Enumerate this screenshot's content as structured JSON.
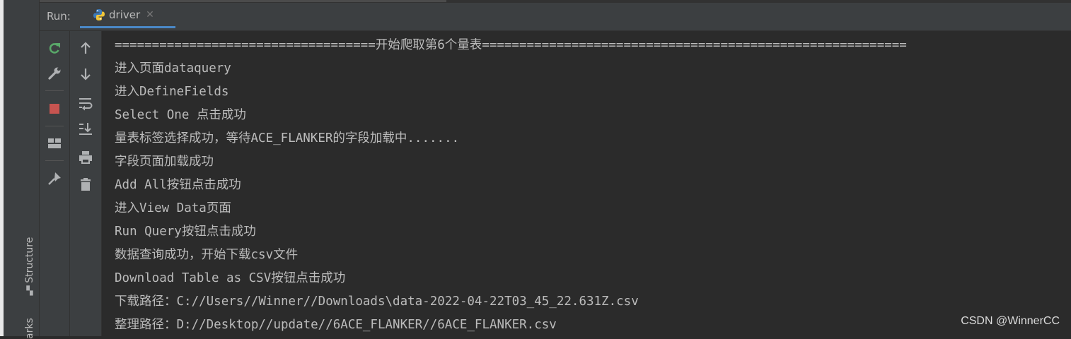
{
  "side": {
    "structure_label": "Structure",
    "bookmarks_label": "arks"
  },
  "run": {
    "label": "Run:",
    "tab_label": "driver"
  },
  "console": {
    "lines": [
      "===================================开始爬取第6个量表=========================================================",
      "进入页面dataquery",
      "进入DefineFields",
      "Select One 点击成功",
      "量表标签选择成功，等待ACE_FLANKER的字段加载中.......",
      "字段页面加载成功",
      "Add All按钮点击成功",
      "进入View Data页面",
      "Run Query按钮点击成功",
      "数据查询成功，开始下载csv文件",
      "Download Table as CSV按钮点击成功",
      "下载路径：C://Users//Winner//Downloads\\data-2022-04-22T03_45_22.631Z.csv",
      "整理路径：D://Desktop//update//6ACE_FLANKER//6ACE_FLANKER.csv"
    ]
  },
  "watermark": "CSDN @WinnerCC",
  "toolbar_icons": [
    "rerun-icon",
    "wrench-icon",
    "stop-icon",
    "layout-icon",
    "pin-icon",
    "up-arrow-icon",
    "down-arrow-icon",
    "soft-wrap-icon",
    "scroll-to-end-icon",
    "print-icon",
    "trash-icon"
  ],
  "colors": {
    "accent": "#4a88c7",
    "rerun": "#59a869",
    "stop": "#c75450",
    "text": "#bbbbbb"
  }
}
